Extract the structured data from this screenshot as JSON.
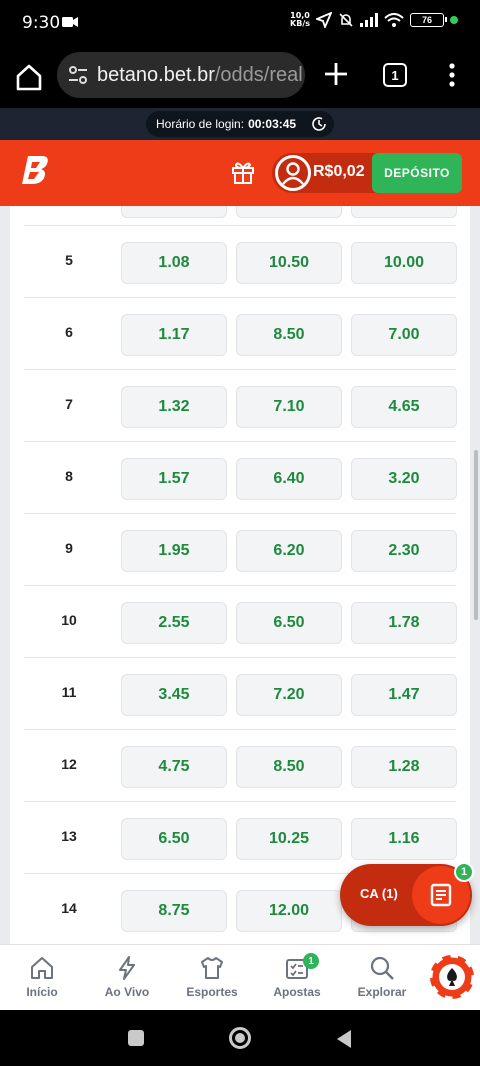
{
  "status_bar": {
    "time": "9:30",
    "net_speed_value": "10,0",
    "net_speed_unit": "KB/s",
    "battery": "76"
  },
  "browser": {
    "url_host": "betano.bet.br",
    "url_path": "/odds/real",
    "tab_count": "1"
  },
  "login_bar": {
    "label": "Horário de login:",
    "time": "00:03:45"
  },
  "header": {
    "balance": "R$0,02",
    "deposit_label": "DEPÓSITO",
    "brand_color": "#ee3b18",
    "deposit_color": "#2fb457"
  },
  "odds_table": {
    "rows": [
      {
        "label": "5",
        "odds": [
          "1.08",
          "10.50",
          "10.00"
        ]
      },
      {
        "label": "6",
        "odds": [
          "1.17",
          "8.50",
          "7.00"
        ]
      },
      {
        "label": "7",
        "odds": [
          "1.32",
          "7.10",
          "4.65"
        ]
      },
      {
        "label": "8",
        "odds": [
          "1.57",
          "6.40",
          "3.20"
        ]
      },
      {
        "label": "9",
        "odds": [
          "1.95",
          "6.20",
          "2.30"
        ]
      },
      {
        "label": "10",
        "odds": [
          "2.55",
          "6.50",
          "1.78"
        ]
      },
      {
        "label": "11",
        "odds": [
          "3.45",
          "7.20",
          "1.47"
        ]
      },
      {
        "label": "12",
        "odds": [
          "4.75",
          "8.50",
          "1.28"
        ]
      },
      {
        "label": "13",
        "odds": [
          "6.50",
          "10.25",
          "1.16"
        ]
      },
      {
        "label": "14",
        "odds": [
          "8.75",
          "12.00",
          ""
        ]
      }
    ],
    "odds_color": "#1e8a3d"
  },
  "betslip": {
    "code": "CA (1)",
    "count": "1"
  },
  "bottom_nav": {
    "items": [
      {
        "label": "Início",
        "icon": "home-icon"
      },
      {
        "label": "Ao Vivo",
        "icon": "lightning-icon"
      },
      {
        "label": "Esportes",
        "icon": "jersey-icon"
      },
      {
        "label": "Apostas",
        "icon": "betslip-check-icon",
        "badge": "1"
      },
      {
        "label": "Explorar",
        "icon": "search-icon"
      }
    ]
  }
}
